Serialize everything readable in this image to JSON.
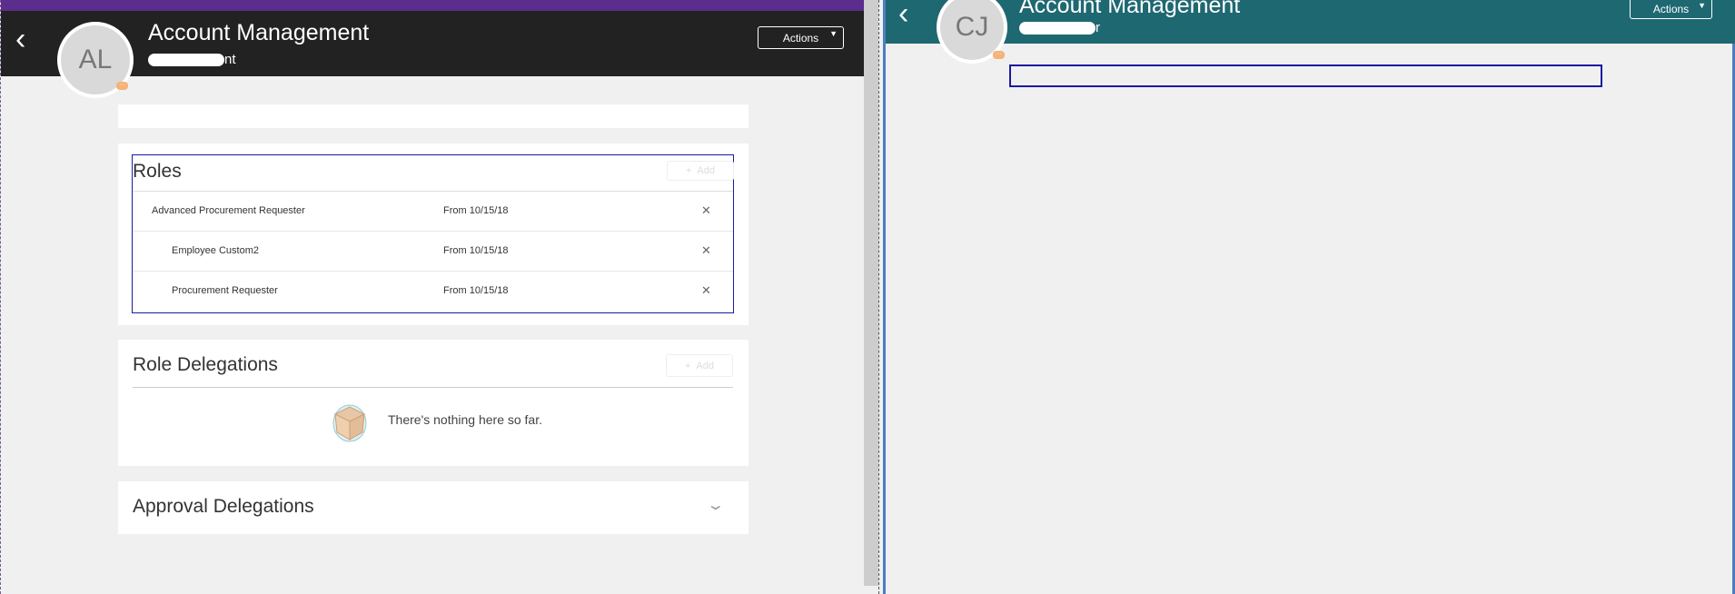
{
  "left_panel": {
    "header": {
      "title": "Account Management",
      "subtitle_visible": "nt",
      "avatar_initials": "AL",
      "actions_label": "Actions"
    },
    "roles": {
      "title": "Roles",
      "add_label": "Add",
      "items": [
        {
          "name": "Advanced Procurement Requester",
          "date": "From 10/15/18"
        },
        {
          "name": "Employee Custom2",
          "date": "From 10/15/18"
        },
        {
          "name": "Procurement Requester",
          "date": "From 10/15/18"
        }
      ]
    },
    "role_delegations": {
      "title": "Role Delegations",
      "add_label": "Add",
      "empty_text": "There's nothing here so far."
    },
    "approval_delegations": {
      "title": "Approval Delegations"
    }
  },
  "right_panel": {
    "header": {
      "title": "Account Management",
      "subtitle_visible": "r",
      "avatar_initials": "CJ",
      "actions_label": "Actions"
    }
  }
}
